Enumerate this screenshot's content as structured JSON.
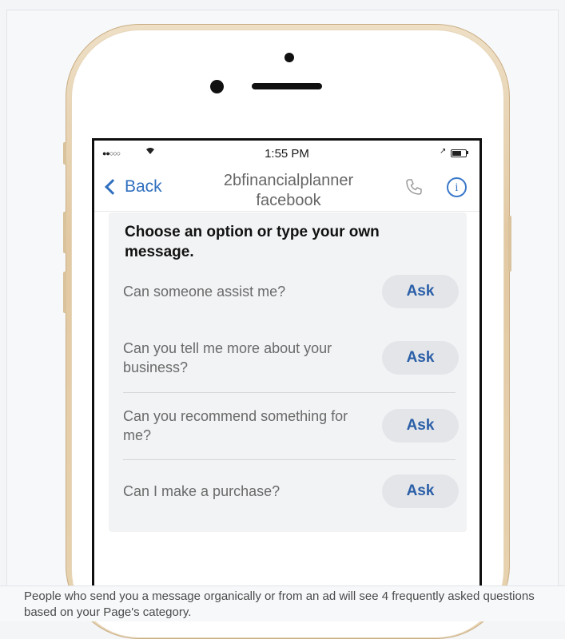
{
  "status_bar": {
    "signal": "●●○○○",
    "time": "1:55 PM"
  },
  "nav": {
    "back_label": "Back",
    "title_line1": "2bfinancialplanner",
    "title_line2": "facebook",
    "info_glyph": "i"
  },
  "card": {
    "heading": "Choose an option or type your own message."
  },
  "options": [
    {
      "question": "Can someone assist me?",
      "button": "Ask"
    },
    {
      "question": "Can you tell me more about your business?",
      "button": "Ask"
    },
    {
      "question": "Can you recommend something for me?",
      "button": "Ask"
    },
    {
      "question": "Can I make a purchase?",
      "button": "Ask"
    }
  ],
  "caption": "People who send you a message organically or from an ad will see 4 frequently asked questions based on your Page's category.",
  "icons": {
    "back": "chevron-left-icon",
    "call": "phone-icon",
    "info": "info-icon",
    "wifi": "wifi-icon",
    "battery": "battery-icon"
  },
  "colors": {
    "accent": "#2f6fbf",
    "phone_frame": "#e2c9a3",
    "button_bg": "#e3e5e8"
  }
}
